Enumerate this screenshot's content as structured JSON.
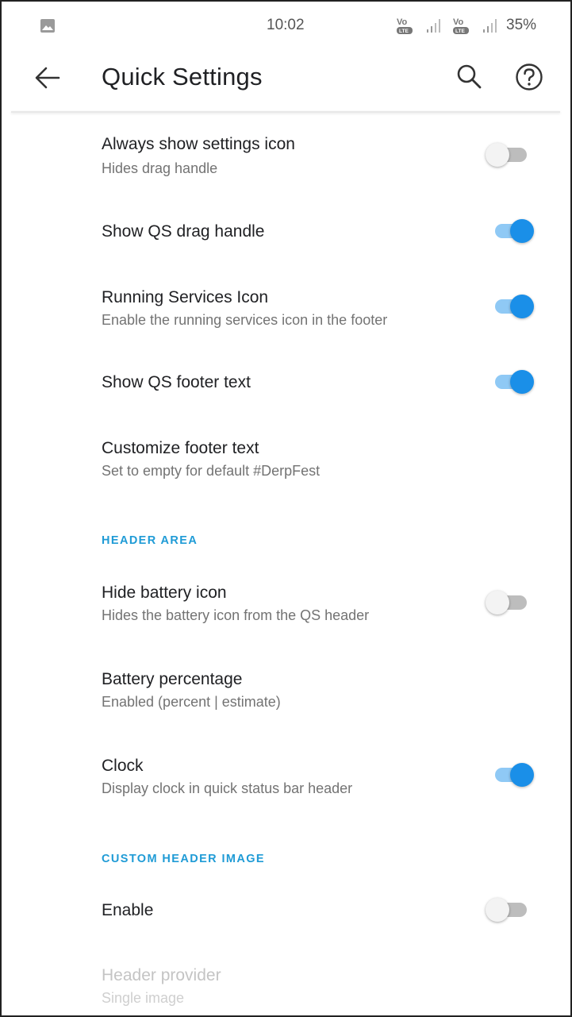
{
  "status_bar": {
    "time": "10:02",
    "battery": "35%",
    "icons": [
      "gallery-icon",
      "volte-icon",
      "signal-icon",
      "volte-icon",
      "signal-icon"
    ]
  },
  "toolbar": {
    "title": "Quick Settings",
    "back_icon": "arrow-back-icon",
    "search_icon": "search-icon",
    "help_icon": "help-icon"
  },
  "preferences": [
    {
      "title": "Always show settings icon",
      "summary": "Hides drag handle",
      "switch": false
    },
    {
      "title": "Show QS drag handle",
      "summary": "",
      "switch": true
    },
    {
      "title": "Running Services Icon",
      "summary": "Enable the running services icon in the footer",
      "switch": true
    },
    {
      "title": "Show QS footer text",
      "summary": "",
      "switch": true
    },
    {
      "title": "Customize footer text",
      "summary": "Set to empty for default #DerpFest"
    }
  ],
  "header_area": {
    "label": "HEADER AREA",
    "items": [
      {
        "title": "Hide battery icon",
        "summary": "Hides the battery icon from the QS header",
        "switch": false
      },
      {
        "title": "Battery percentage",
        "summary": "Enabled (percent | estimate)"
      },
      {
        "title": "Clock",
        "summary": "Display clock in quick status bar header",
        "switch": true
      }
    ]
  },
  "custom_header_image": {
    "label": "CUSTOM HEADER IMAGE",
    "items": [
      {
        "title": "Enable",
        "summary": "",
        "switch": false
      },
      {
        "title": "Header provider",
        "summary": "Single image",
        "enabled": false
      }
    ]
  },
  "colors": {
    "accent": "#1a8fe8",
    "section_header": "#1f9bd6",
    "switch_track_on": "#8fc9f5",
    "switch_track_off": "#bdbdbd"
  }
}
